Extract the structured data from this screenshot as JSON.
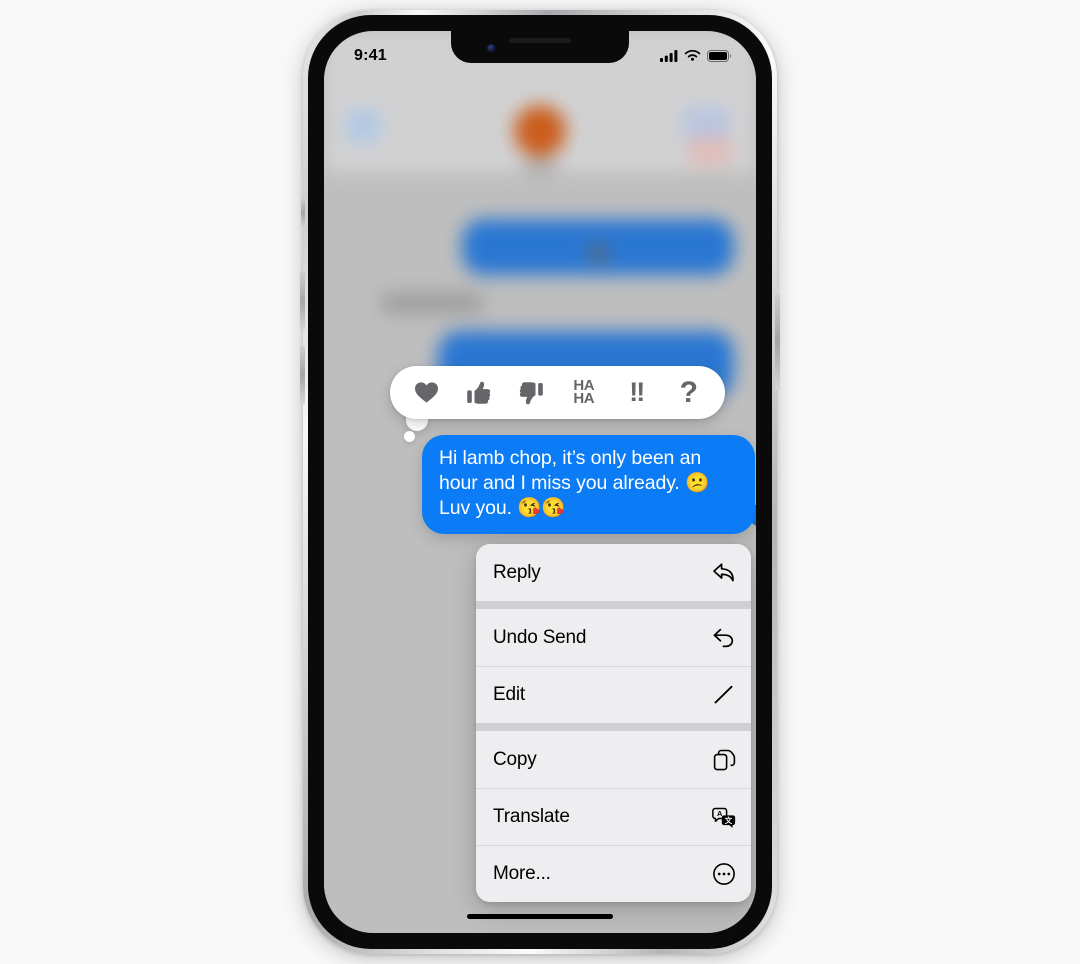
{
  "page": {
    "background_color": "#f8f8f8",
    "device": "iPhone"
  },
  "status_bar": {
    "time": "9:41",
    "icons": [
      "cellular-signal-icon",
      "wifi-icon",
      "battery-icon"
    ]
  },
  "chat": {
    "backdrop_state": "blurred",
    "focused_message": {
      "text": "Hi lamb chop, it’s only been an hour and I miss you already. 😕 Luv you. 😘😘",
      "sender": "me",
      "bubble_color": "#0b7cf5",
      "text_color": "#ffffff"
    }
  },
  "tapback_bar": {
    "items": [
      {
        "name": "heart",
        "glyph": "♥",
        "type": "glyph"
      },
      {
        "name": "thumbs-up",
        "glyph": "👍",
        "type": "glyph"
      },
      {
        "name": "thumbs-down",
        "glyph": "👎",
        "type": "glyph"
      },
      {
        "name": "haha",
        "label_line1": "HA",
        "label_line2": "HA",
        "type": "text"
      },
      {
        "name": "exclamation",
        "label": "!!",
        "type": "text"
      },
      {
        "name": "question",
        "label": "?",
        "type": "text"
      }
    ]
  },
  "context_menu": {
    "groups": [
      {
        "items": [
          {
            "label": "Reply",
            "icon": "reply-arrow-icon"
          }
        ]
      },
      {
        "items": [
          {
            "label": "Undo Send",
            "icon": "undo-arrow-icon"
          },
          {
            "label": "Edit",
            "icon": "pencil-icon"
          }
        ]
      },
      {
        "items": [
          {
            "label": "Copy",
            "icon": "copy-duplicate-icon"
          },
          {
            "label": "Translate",
            "icon": "translate-bubbles-icon"
          },
          {
            "label": "More...",
            "icon": "ellipsis-circle-icon"
          }
        ]
      }
    ]
  }
}
